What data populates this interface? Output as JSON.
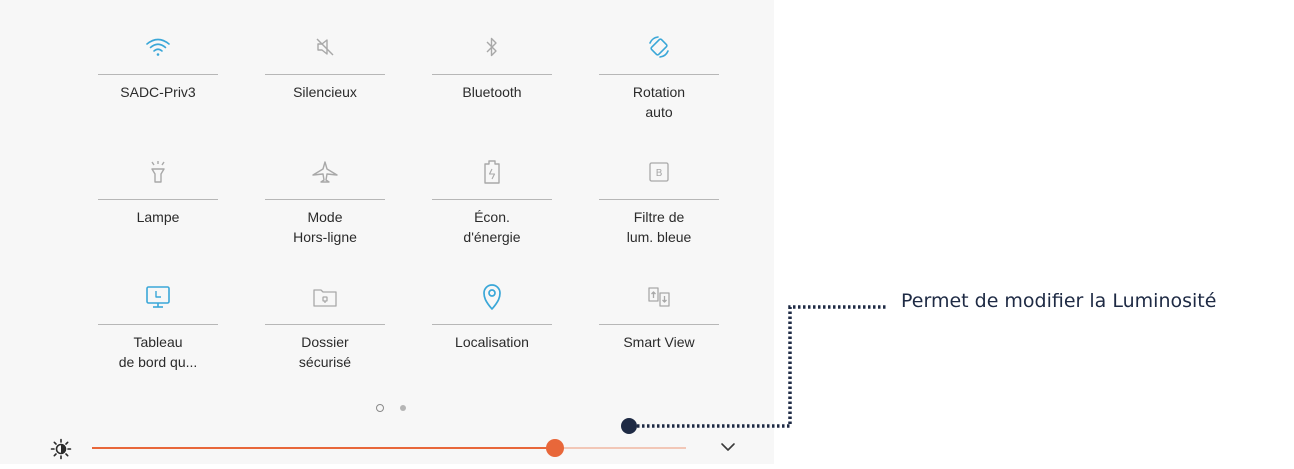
{
  "tiles": [
    {
      "icon": "wifi-icon",
      "active": true,
      "lines": [
        "SADC-Priv3"
      ]
    },
    {
      "icon": "mute-icon",
      "active": false,
      "lines": [
        "Silencieux"
      ]
    },
    {
      "icon": "bluetooth-icon",
      "active": false,
      "lines": [
        "Bluetooth"
      ]
    },
    {
      "icon": "auto-rotate-icon",
      "active": true,
      "lines": [
        "Rotation",
        "auto"
      ]
    },
    {
      "icon": "flashlight-icon",
      "active": false,
      "lines": [
        "Lampe"
      ]
    },
    {
      "icon": "airplane-icon",
      "active": false,
      "lines": [
        "Mode",
        "Hors-ligne"
      ]
    },
    {
      "icon": "battery-saver-icon",
      "active": false,
      "lines": [
        "Écon.",
        "d'énergie"
      ]
    },
    {
      "icon": "blue-light-filter-icon",
      "active": false,
      "lines": [
        "Filtre de",
        "lum. bleue"
      ]
    },
    {
      "icon": "dashboard-icon",
      "active": true,
      "lines": [
        "Tableau",
        "de bord qu..."
      ]
    },
    {
      "icon": "secure-folder-icon",
      "active": false,
      "lines": [
        "Dossier",
        "sécurisé"
      ]
    },
    {
      "icon": "location-icon",
      "active": true,
      "lines": [
        "Localisation"
      ]
    },
    {
      "icon": "smart-view-icon",
      "active": false,
      "lines": [
        "Smart View"
      ]
    }
  ],
  "pager": {
    "pages": 2,
    "current": 1
  },
  "brightness": {
    "level": 0.78,
    "icon": "brightness-icon"
  },
  "expand_icon": "chevron-down-icon",
  "annotation": {
    "text": "Permet de modifier la Luminosité"
  },
  "colors": {
    "active": "#3aa7d8",
    "inactive": "#a8a8a8",
    "slider": "#e8673a",
    "annotation": "#1e2a44"
  }
}
